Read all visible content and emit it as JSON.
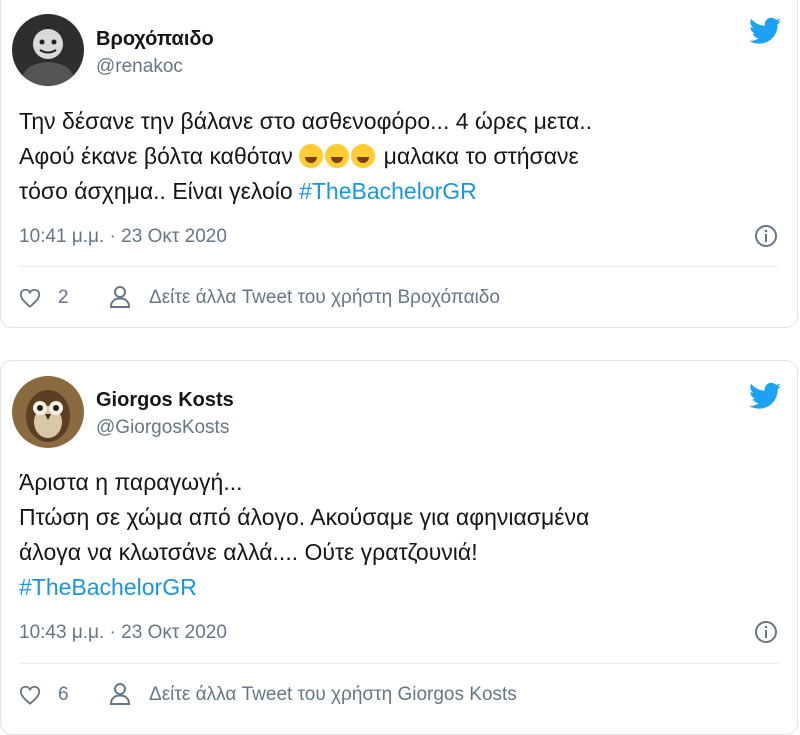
{
  "tweets": [
    {
      "display_name": "Βροχόπαιδο",
      "handle": "@renakoc",
      "body": {
        "line1": "Την δέσανε την βάλανε στο ασθενοφόρο... 4 ώρες μετα..",
        "line2_before": "Αφού έκανε βόλτα καθόταν",
        "emojis": [
          "face-with-tears-of-joy",
          "face-with-tears-of-joy",
          "face-with-tears-of-joy"
        ],
        "line2_after": "μαλακα το στήσανε",
        "line3": "τόσο άσχημα.. Είναι γελοίο",
        "hashtag": "#TheBachelorGR"
      },
      "timestamp": "10:41 μ.μ. · 23 Οκτ 2020",
      "likes": "2",
      "more_tweets": "Δείτε άλλα Tweet του χρήστη Βροχόπαιδο"
    },
    {
      "display_name": "Giorgos Kosts",
      "handle": "@GiorgosKosts",
      "body": {
        "line1": "Άριστα η παραγωγή...",
        "line2": "Πτώση σε χώμα από άλογο. Ακούσαμε για αφηνιασμένα",
        "line3": "άλογα να κλωτσάνε αλλά.... Ούτε γρατζουνιά!",
        "hashtag": "#TheBachelorGR"
      },
      "timestamp": "10:43 μ.μ. · 23 Οκτ 2020",
      "likes": "6",
      "more_tweets": "Δείτε άλλα Tweet του χρήστη Giorgos Kosts"
    }
  ],
  "icons": {
    "twitter_bird": "twitter-bird-icon",
    "info": "info-icon",
    "heart": "heart-icon",
    "person": "person-icon"
  },
  "colors": {
    "twitter_blue": "#1da1f2",
    "hashtag": "#1b95e0",
    "secondary_text": "#657786",
    "border": "#dfe4e8"
  }
}
